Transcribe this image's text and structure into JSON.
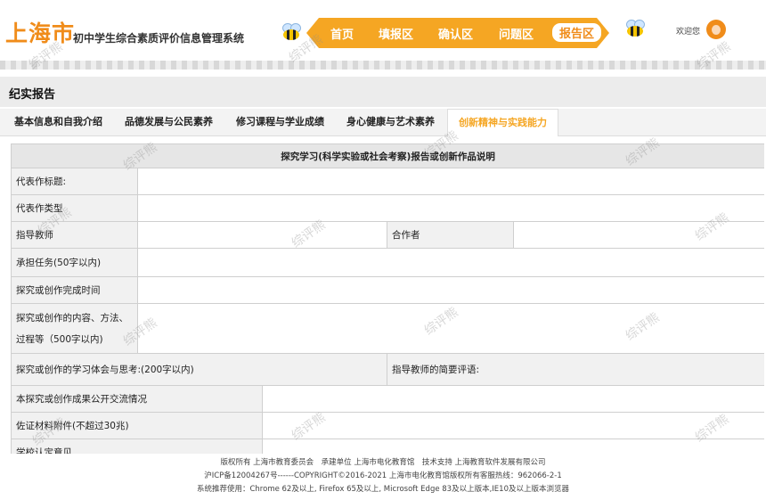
{
  "header": {
    "city": "上海市",
    "system_name": "初中学生综合素质评价信息管理系统",
    "welcome": "欢迎您",
    "nav": [
      {
        "label": "首页",
        "active": false
      },
      {
        "label": "填报区",
        "active": false
      },
      {
        "label": "确认区",
        "active": false
      },
      {
        "label": "问题区",
        "active": false
      },
      {
        "label": "报告区",
        "active": true
      }
    ]
  },
  "section": {
    "title": "纪实报告"
  },
  "tabs": [
    {
      "label": "基本信息和自我介绍",
      "active": false
    },
    {
      "label": "品德发展与公民素养",
      "active": false
    },
    {
      "label": "修习课程与学业成绩",
      "active": false
    },
    {
      "label": "身心健康与艺术素养",
      "active": false
    },
    {
      "label": "创新精神与实践能力",
      "active": true
    }
  ],
  "form": {
    "heading": "探究学习(科学实验或社会考察)报告或创新作品说明",
    "rows": {
      "title": "代表作标题:",
      "type": "代表作类型",
      "teacher": "指导教师",
      "partner": "合作者",
      "task": "承担任务(50字以内)",
      "finish_time": "探究或创作完成时间",
      "content_1": "探究或创作的内容、方法、",
      "content_2": "过程等（500字以内)",
      "reflection": "探究或创作的学习体会与思考:(200字以内)",
      "teacher_comment": "指导教师的简要评语:",
      "exchange": "本探究或创作成果公开交流情况",
      "evidence": "佐证材料附件(不超过30兆)",
      "school_opinion": "学校认定意见"
    }
  },
  "footer": {
    "line1": "版权所有 上海市教育委员会　承建单位 上海市电化教育馆　技术支持 上海教育软件发展有限公司",
    "line2": "沪ICP备12004267号------COPYRIGHT©2016-2021 上海市电化教育馆版权所有客服热线：962066-2-1",
    "line3": "系统推荐使用：Chrome 62及以上, Firefox 65及以上, Microsoft Edge 83及以上版本,IE10及以上版本浏览器"
  },
  "watermark": "综评熊"
}
